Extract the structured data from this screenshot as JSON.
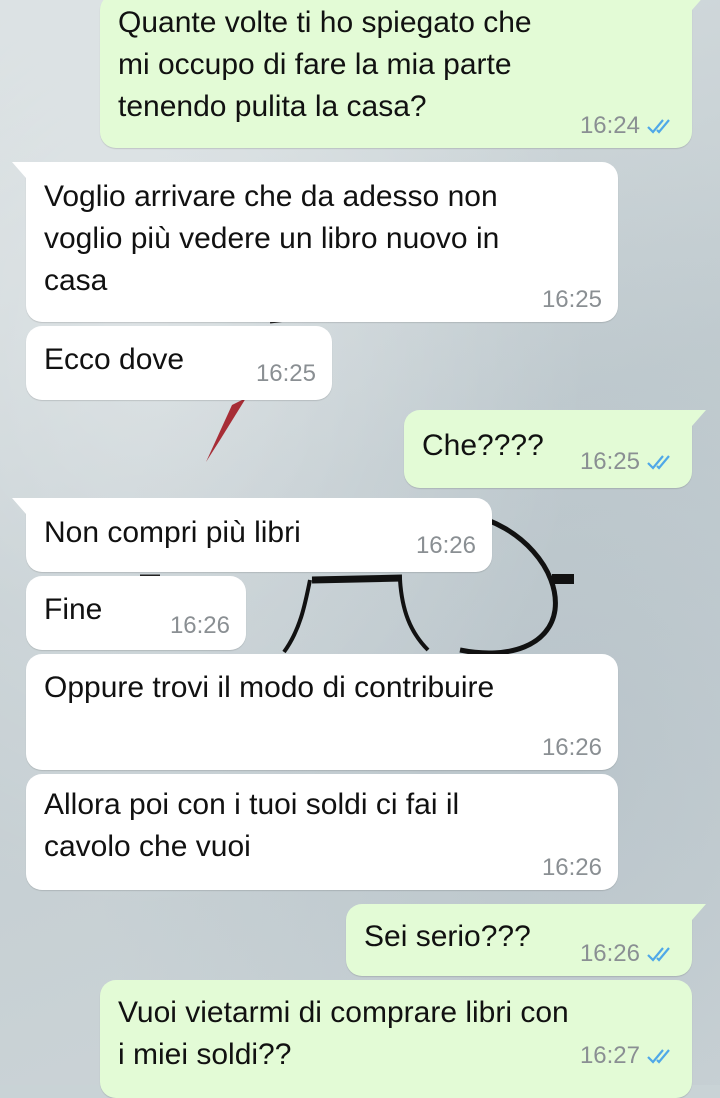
{
  "colors": {
    "incoming_bubble": "#ffffff",
    "outgoing_bubble": "#e3fbd6",
    "timestamp": "#8a8f93",
    "read_ticks": "#4fa8e8"
  },
  "messages": [
    {
      "direction": "outgoing",
      "text": "Quante volte ti ho spiegato che\nmi occupo di fare la mia parte\ntenendo pulita la casa?",
      "time": "16:24",
      "status": "read-double-check-icon"
    },
    {
      "direction": "incoming",
      "text": "Voglio arrivare che da adesso non\nvoglio più vedere un libro nuovo in\ncasa",
      "time": "16:25"
    },
    {
      "direction": "incoming",
      "text": "Ecco dove",
      "time": "16:25"
    },
    {
      "direction": "outgoing",
      "text": "Che????",
      "time": "16:25",
      "status": "read-double-check-icon"
    },
    {
      "direction": "incoming",
      "text": "Non compri più libri",
      "time": "16:26"
    },
    {
      "direction": "incoming",
      "text": "Fine",
      "time": "16:26"
    },
    {
      "direction": "incoming",
      "text": "Oppure trovi il modo di contribuire",
      "time": "16:26"
    },
    {
      "direction": "incoming",
      "text": "Allora poi con i tuoi soldi ci fai il\ncavolo che vuoi",
      "time": "16:26"
    },
    {
      "direction": "outgoing",
      "text": "Sei serio???",
      "time": "16:26",
      "status": "read-double-check-icon"
    },
    {
      "direction": "outgoing",
      "text": "Vuoi vietarmi di comprare libri con\ni miei soldi??",
      "time": "16:27",
      "status": "read-double-check-icon"
    }
  ]
}
